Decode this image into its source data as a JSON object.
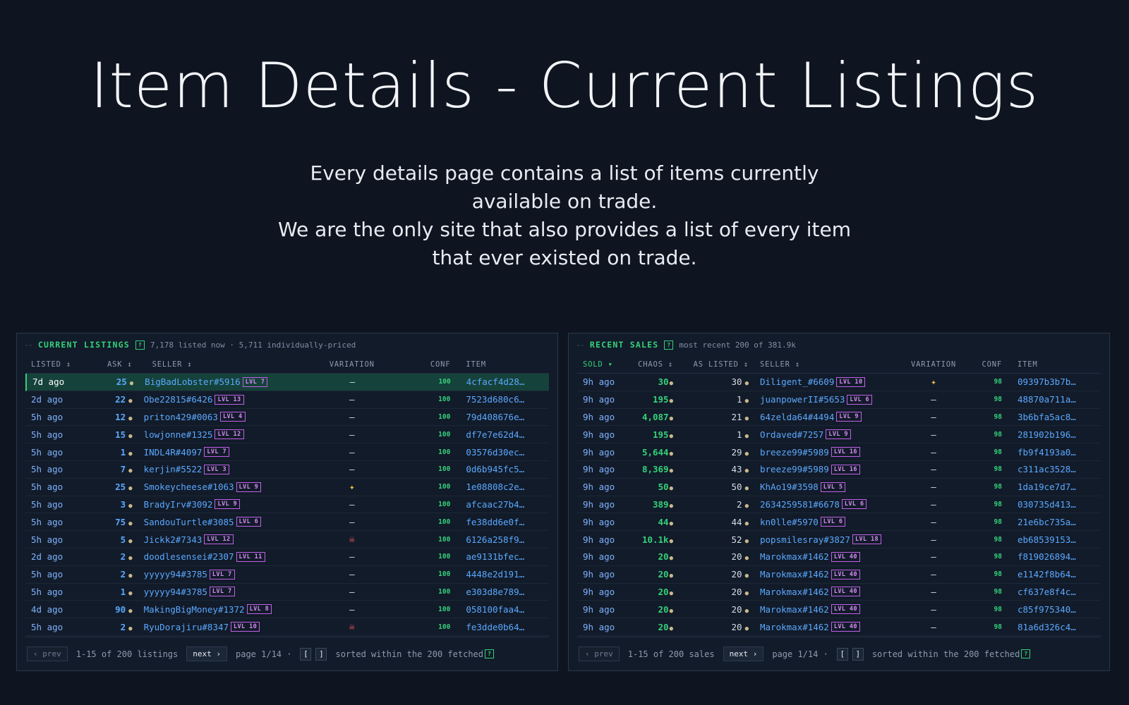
{
  "hero": {
    "title": "Item Details - Current Listings",
    "subtitle_lines": [
      "Every details page contains a list of items currently",
      "available on trade.",
      "We are the only site that also provides a list of every item",
      "that ever existed on trade."
    ]
  },
  "listings": {
    "dash": "--",
    "title": "CURRENT LISTINGS",
    "help": "?",
    "meta": "7,178 listed now · 5,711 individually-priced",
    "columns": {
      "listed": "LISTED ↕",
      "ask": "ASK ↕",
      "seller": "SELLER ↕",
      "variation": "VARIATION",
      "conf": "CONF",
      "item": "ITEM"
    },
    "rows": [
      {
        "time": "7d ago",
        "ask": "25",
        "seller": "BigBadLobster#5916",
        "lvl": "LVL 7",
        "variation": "–",
        "conf": "100",
        "item": "4cfacf4d28…"
      },
      {
        "time": "2d ago",
        "ask": "22",
        "seller": "Obe22815#6426",
        "lvl": "LVL 13",
        "variation": "–",
        "conf": "100",
        "item": "7523d680c6…"
      },
      {
        "time": "5h ago",
        "ask": "12",
        "seller": "priton429#0063",
        "lvl": "LVL 4",
        "variation": "–",
        "conf": "100",
        "item": "79d408676e…"
      },
      {
        "time": "5h ago",
        "ask": "15",
        "seller": "lowjonne#1325",
        "lvl": "LVL 12",
        "variation": "–",
        "conf": "100",
        "item": "df7e7e62d4…"
      },
      {
        "time": "5h ago",
        "ask": "1",
        "seller": "INDL4R#4097",
        "lvl": "LVL 7",
        "variation": "–",
        "conf": "100",
        "item": "03576d30ec…"
      },
      {
        "time": "5h ago",
        "ask": "7",
        "seller": "kerjin#5522",
        "lvl": "LVL 3",
        "variation": "–",
        "conf": "100",
        "item": "0d6b945fc5…"
      },
      {
        "time": "5h ago",
        "ask": "25",
        "seller": "Smokeycheese#1063",
        "lvl": "LVL 9",
        "variation": "✦",
        "conf": "100",
        "item": "1e08808c2e…"
      },
      {
        "time": "5h ago",
        "ask": "3",
        "seller": "BradyIrv#3092",
        "lvl": "LVL 9",
        "variation": "–",
        "conf": "100",
        "item": "afcaac27b4…"
      },
      {
        "time": "5h ago",
        "ask": "75",
        "seller": "SandouTurtle#3085",
        "lvl": "LVL 6",
        "variation": "–",
        "conf": "100",
        "item": "fe38dd6e0f…"
      },
      {
        "time": "5h ago",
        "ask": "5",
        "seller": "Jickk2#7343",
        "lvl": "LVL 12",
        "variation": "☠",
        "conf": "100",
        "item": "6126a258f9…"
      },
      {
        "time": "2d ago",
        "ask": "2",
        "seller": "doodlesensei#2307",
        "lvl": "LVL 11",
        "variation": "–",
        "conf": "100",
        "item": "ae9131bfec…"
      },
      {
        "time": "5h ago",
        "ask": "2",
        "seller": "yyyyy94#3785",
        "lvl": "LVL 7",
        "variation": "–",
        "conf": "100",
        "item": "4448e2d191…"
      },
      {
        "time": "5h ago",
        "ask": "1",
        "seller": "yyyyy94#3785",
        "lvl": "LVL 7",
        "variation": "–",
        "conf": "100",
        "item": "e303d8e789…"
      },
      {
        "time": "4d ago",
        "ask": "90",
        "seller": "MakingBigMoney#1372",
        "lvl": "LVL 8",
        "variation": "–",
        "conf": "100",
        "item": "058100faa4…"
      },
      {
        "time": "5h ago",
        "ask": "2",
        "seller": "RyuDorajiru#8347",
        "lvl": "LVL 10",
        "variation": "☠",
        "conf": "100",
        "item": "fe3dde0b64…"
      }
    ],
    "footer": {
      "prev": "‹ prev",
      "range": "1-15 of 200 listings",
      "next": "next ›",
      "page": "page 1/14 ·",
      "key_left": "[",
      "key_right": "]",
      "sorted": "sorted within the 200 fetched",
      "help": "?"
    }
  },
  "sales": {
    "dash": "--",
    "title": "RECENT SALES",
    "help": "?",
    "meta": "most recent 200 of 381.9k",
    "columns": {
      "sold": "SOLD ▾",
      "chaos": "CHAOS ↕",
      "as_listed": "AS LISTED ↕",
      "seller": "SELLER ↕",
      "variation": "VARIATION",
      "conf": "CONF",
      "item": "ITEM"
    },
    "rows": [
      {
        "time": "9h ago",
        "chaos": "30",
        "listed": "30",
        "seller": "Diligent_#6609",
        "lvl": "LVL 10",
        "variation": "✦",
        "conf": "98",
        "item": "09397b3b7b…"
      },
      {
        "time": "9h ago",
        "chaos": "195",
        "listed": "1",
        "seller": "juanpowerII#5653",
        "lvl": "LVL 6",
        "variation": "–",
        "conf": "98",
        "item": "48870a711a…"
      },
      {
        "time": "9h ago",
        "chaos": "4,087",
        "listed": "21",
        "seller": "64zelda64#4494",
        "lvl": "LVL 9",
        "variation": "–",
        "conf": "98",
        "item": "3b6bfa5ac8…"
      },
      {
        "time": "9h ago",
        "chaos": "195",
        "listed": "1",
        "seller": "Ordaved#7257",
        "lvl": "LVL 9",
        "variation": "–",
        "conf": "98",
        "item": "281902b196…"
      },
      {
        "time": "9h ago",
        "chaos": "5,644",
        "listed": "29",
        "seller": "breeze99#5989",
        "lvl": "LVL 16",
        "variation": "–",
        "conf": "98",
        "item": "fb9f4193a0…"
      },
      {
        "time": "9h ago",
        "chaos": "8,369",
        "listed": "43",
        "seller": "breeze99#5989",
        "lvl": "LVL 16",
        "variation": "–",
        "conf": "98",
        "item": "c311ac3528…"
      },
      {
        "time": "9h ago",
        "chaos": "50",
        "listed": "50",
        "seller": "KhAo19#3598",
        "lvl": "LVL 5",
        "variation": "–",
        "conf": "98",
        "item": "1da19ce7d7…"
      },
      {
        "time": "9h ago",
        "chaos": "389",
        "listed": "2",
        "seller": "2634259581#6678",
        "lvl": "LVL 6",
        "variation": "–",
        "conf": "98",
        "item": "030735d413…"
      },
      {
        "time": "9h ago",
        "chaos": "44",
        "listed": "44",
        "seller": "kn0lle#5970",
        "lvl": "LVL 6",
        "variation": "–",
        "conf": "98",
        "item": "21e6bc735a…"
      },
      {
        "time": "9h ago",
        "chaos": "10.1k",
        "listed": "52",
        "seller": "popsmilesray#3827",
        "lvl": "LVL 18",
        "variation": "–",
        "conf": "98",
        "item": "eb68539153…"
      },
      {
        "time": "9h ago",
        "chaos": "20",
        "listed": "20",
        "seller": "Marokmax#1462",
        "lvl": "LVL 40",
        "variation": "–",
        "conf": "98",
        "item": "f819026894…"
      },
      {
        "time": "9h ago",
        "chaos": "20",
        "listed": "20",
        "seller": "Marokmax#1462",
        "lvl": "LVL 40",
        "variation": "–",
        "conf": "98",
        "item": "e1142f8b64…"
      },
      {
        "time": "9h ago",
        "chaos": "20",
        "listed": "20",
        "seller": "Marokmax#1462",
        "lvl": "LVL 40",
        "variation": "–",
        "conf": "98",
        "item": "cf637e8f4c…"
      },
      {
        "time": "9h ago",
        "chaos": "20",
        "listed": "20",
        "seller": "Marokmax#1462",
        "lvl": "LVL 40",
        "variation": "–",
        "conf": "98",
        "item": "c85f975340…"
      },
      {
        "time": "9h ago",
        "chaos": "20",
        "listed": "20",
        "seller": "Marokmax#1462",
        "lvl": "LVL 40",
        "variation": "–",
        "conf": "98",
        "item": "81a6d326c4…"
      }
    ],
    "footer": {
      "prev": "‹ prev",
      "range": "1-15 of 200 sales",
      "next": "next ›",
      "page": "page 1/14 ·",
      "key_left": "[",
      "key_right": "]",
      "sorted": "sorted within the 200 fetched",
      "help": "?"
    }
  },
  "colors": {
    "background": "#0e1420",
    "panel": "#121b29",
    "accent_green": "#34d17b",
    "link_blue": "#5aa8ff",
    "level_purple": "#c160e8",
    "highlight_row": "#15423a"
  },
  "icons": {
    "currency": "chaos-orb-icon",
    "variation_special": "sparkle-icon",
    "variation_corrupted": "skull-icon",
    "help": "help-icon"
  }
}
